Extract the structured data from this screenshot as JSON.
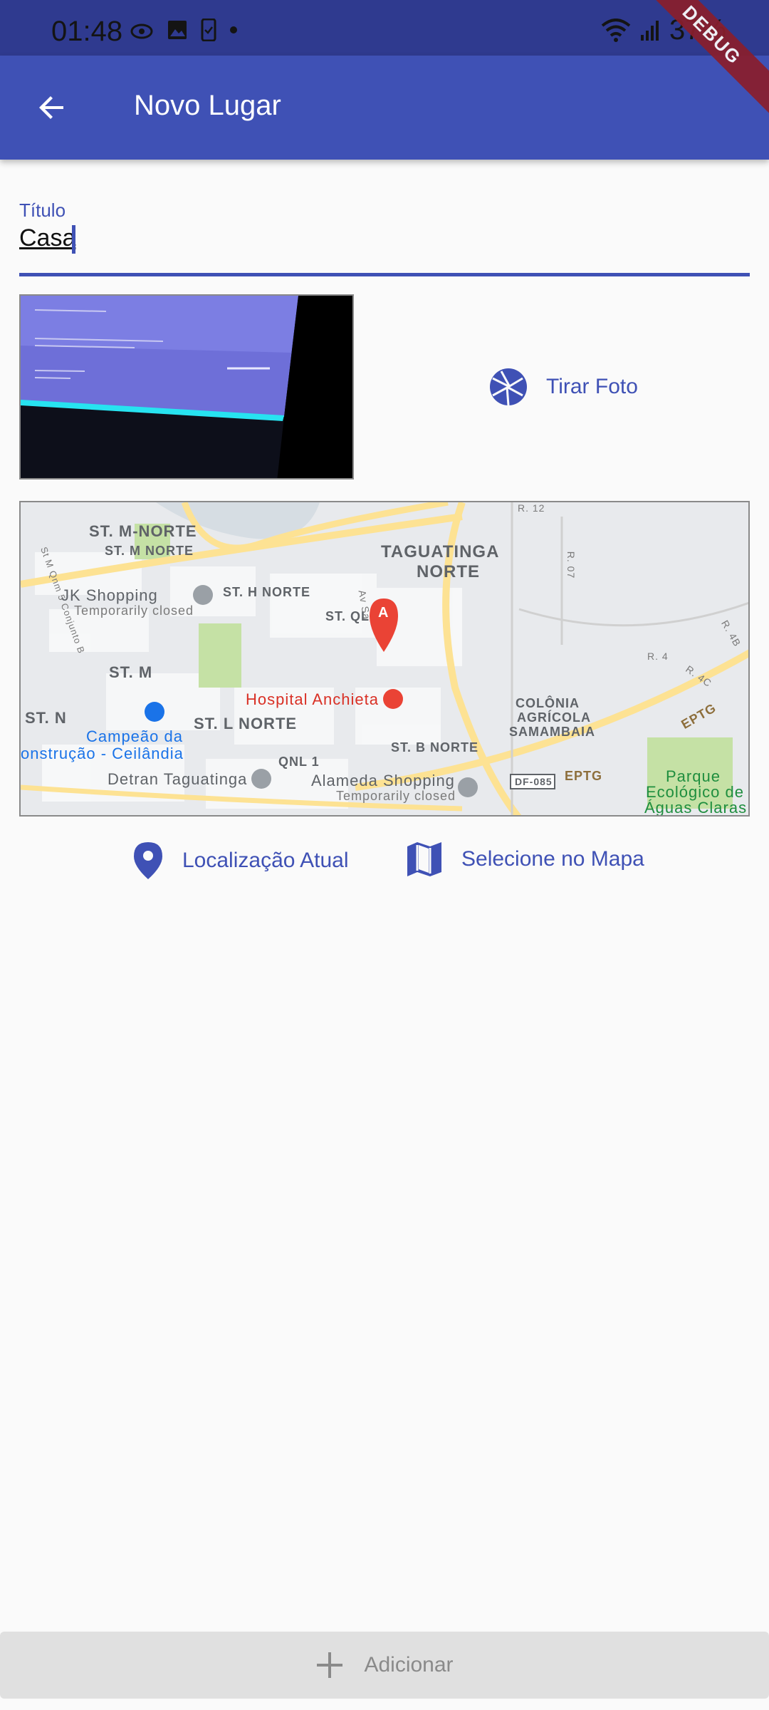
{
  "status_bar": {
    "time": "01:48",
    "battery": "37%"
  },
  "app_bar": {
    "title": "Novo Lugar",
    "debug": "DEBUG"
  },
  "form": {
    "title_label": "Título",
    "title_value": "Casa"
  },
  "photo": {
    "take_photo_label": "Tirar Foto"
  },
  "map": {
    "labels": {
      "st_m_norte": "ST. M-NORTE",
      "st_m_norte_small": "ST. M NORTE",
      "taguatinga": "TAGUATINGA",
      "norte": "NORTE",
      "jk": "JK Shopping",
      "temporarily": "Temporarily closed",
      "st_h_norte": "ST. H NORTE",
      "st_m": "ST. M",
      "st_n": "ST. N",
      "st_l_norte": "ST. L NORTE",
      "hospital": "Hospital Anchieta",
      "colonia": "COLÔNIA",
      "agricola": "AGRÍCOLA",
      "samambaia": "SAMAMBAIA",
      "campeao1": "Campeão da",
      "campeao2": "onstrução - Ceilândia",
      "detran": "Detran Taguatinga",
      "qnl1": "QNL 1",
      "alameda": "Alameda Shopping",
      "st_b_norte": "ST. B NORTE",
      "df085": "DF-085",
      "eptg": "EPTG",
      "eptg2": "EPTG",
      "parque1": "Parque",
      "parque2": "Ecológico de",
      "parque3": "Águas Claras",
      "r12": "R. 12",
      "r07": "R. 07",
      "r4": "R. 4",
      "r4c": "R. 4C",
      "r4b": "R. 4B",
      "st_ql": "ST. QL",
      "av": "Av Sa",
      "conjunto": "St M Qnm 5 Conjunto B",
      "marker": "A"
    }
  },
  "actions": {
    "current_location": "Localização Atual",
    "select_on_map": "Selecione no Mapa"
  },
  "add_button": {
    "label": "Adicionar"
  },
  "colors": {
    "primary": "#3f51b5",
    "status_bar": "#2f3a8f",
    "background": "#fafafa"
  }
}
